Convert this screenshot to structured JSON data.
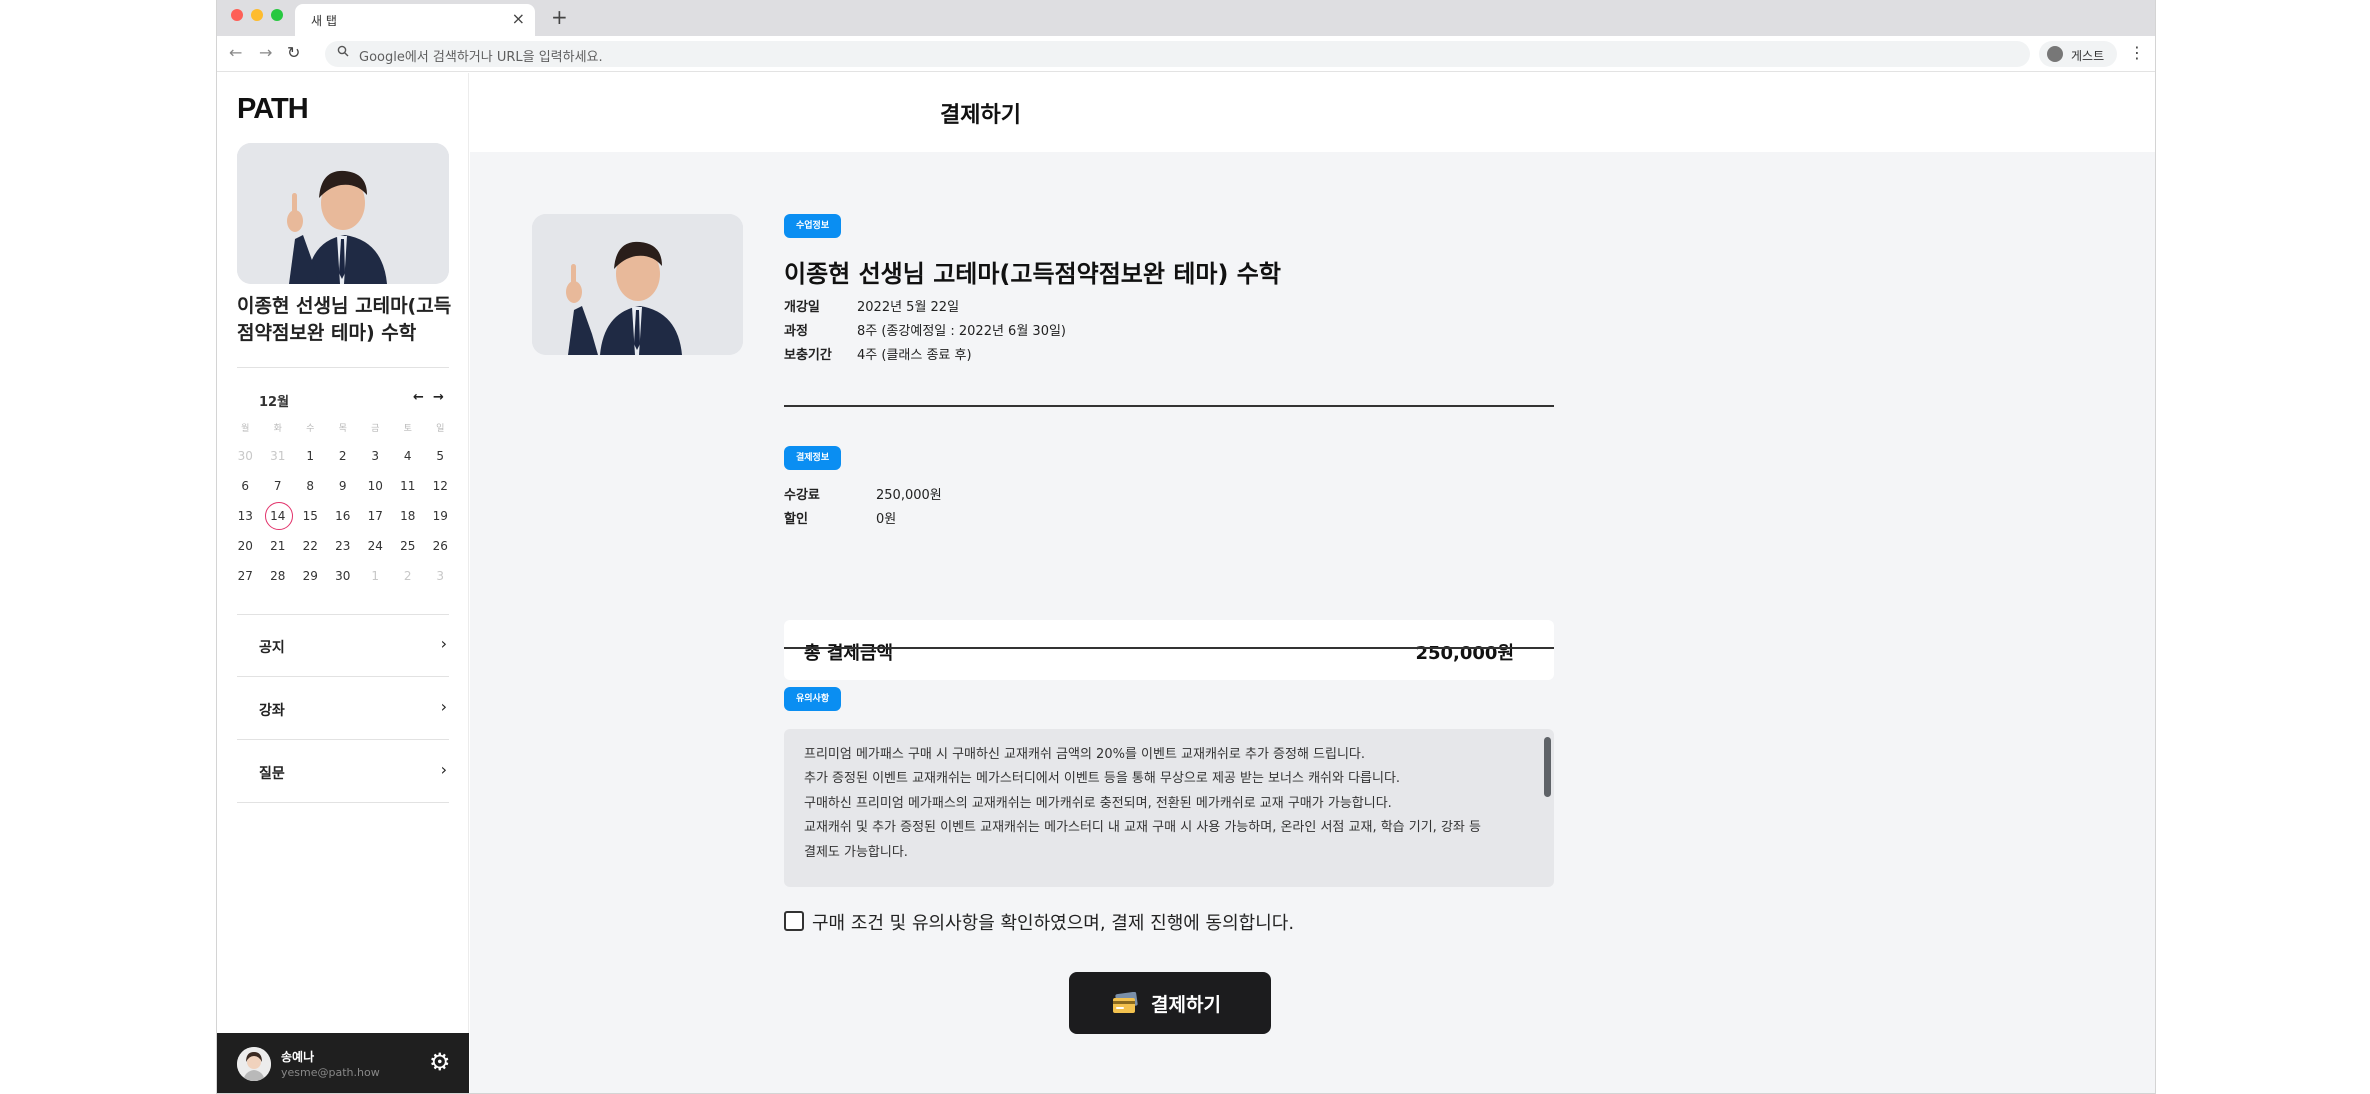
{
  "browser": {
    "tab_title": "새 탭",
    "tab_close": "×",
    "new_tab": "+",
    "address_placeholder": "Google에서 검색하거나 URL을 입력하세요.",
    "profile_label": "게스트"
  },
  "sidebar": {
    "logo": "PATH",
    "course_title": "이종현 선생님 고테마(고득점약점보완 테마) 수학",
    "calendar": {
      "month": "12월",
      "weekdays": [
        "월",
        "화",
        "수",
        "목",
        "금",
        "토",
        "일"
      ],
      "weeks": [
        [
          "30",
          "31",
          "1",
          "2",
          "3",
          "4",
          "5"
        ],
        [
          "6",
          "7",
          "8",
          "9",
          "10",
          "11",
          "12"
        ],
        [
          "13",
          "14",
          "15",
          "16",
          "17",
          "18",
          "19"
        ],
        [
          "20",
          "21",
          "22",
          "23",
          "24",
          "25",
          "26"
        ],
        [
          "27",
          "28",
          "29",
          "30",
          "1",
          "2",
          "3"
        ]
      ],
      "today": "14"
    },
    "links": [
      {
        "label": "공지"
      },
      {
        "label": "강좌"
      },
      {
        "label": "질문"
      }
    ],
    "user": {
      "name": "송예나",
      "email": "yesme@path.how"
    }
  },
  "main": {
    "page_title": "결제하기",
    "class_info": {
      "badge": "수업정보",
      "title": "이종현 선생님 고테마(고득점약점보완 테마) 수학",
      "rows": [
        {
          "label": "개강일",
          "value": "2022년 5월 22일"
        },
        {
          "label": "과정",
          "value": "8주 (종강예정일 : 2022년 6월 30일)"
        },
        {
          "label": "보충기간",
          "value": "4주 (클래스 종료 후)"
        }
      ]
    },
    "payment_info": {
      "badge": "결제정보",
      "rows": [
        {
          "label": "수강료",
          "value": "250,000원"
        },
        {
          "label": "할인",
          "value": "0원"
        }
      ],
      "total_label": "총 결제금액",
      "total_value": "250,000원"
    },
    "notice": {
      "badge": "유의사항",
      "lines": [
        "프리미엄 메가패스 구매 시 구매하신 교재캐쉬 금액의 20%를 이벤트 교재캐쉬로 추가 증정해 드립니다.",
        "추가 증정된 이벤트 교재캐쉬는 메가스터디에서 이벤트 등을 통해 무상으로 제공 받는 보너스 캐쉬와 다릅니다.",
        "구매하신 프리미엄 메가패스의 교재캐쉬는 메가캐쉬로 충전되며, 전환된 메가캐쉬로 교재 구매가 가능합니다.",
        "교재캐쉬 및 추가 증정된 이벤트 교재캐쉬는 메가스터디 내 교재 구매 시 사용 가능하며, 온라인 서점 교재, 학습 기기, 강좌 등",
        "결제도 가능합니다."
      ]
    },
    "agree_text": "구매 조건 및 유의사항을 확인하였으며, 결제 진행에 동의합니다.",
    "pay_button": "결제하기"
  }
}
